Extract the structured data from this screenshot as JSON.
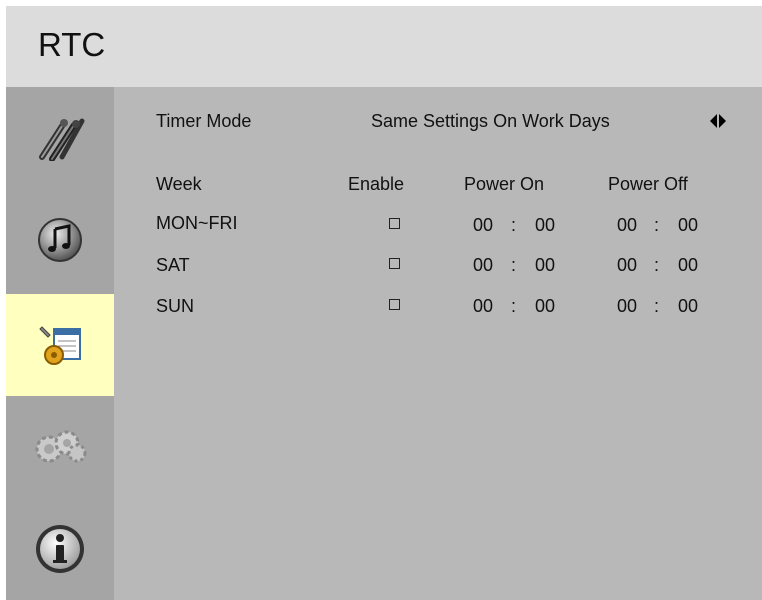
{
  "header": {
    "title": "RTC"
  },
  "sidebar": {
    "items": [
      {
        "icon": "wrench-tools-icon",
        "active": false
      },
      {
        "icon": "music-note-icon",
        "active": false
      },
      {
        "icon": "settings-calendar-icon",
        "active": true
      },
      {
        "icon": "gears-icon",
        "active": false
      },
      {
        "icon": "info-icon",
        "active": false
      }
    ]
  },
  "timer_mode": {
    "label": "Timer Mode",
    "value": "Same Settings On Work Days",
    "arrow_icon": "left-right-arrow-icon"
  },
  "table": {
    "headers": {
      "week": "Week",
      "enable": "Enable",
      "power_on": "Power On",
      "power_off": "Power Off"
    },
    "rows": [
      {
        "day": "MON~FRI",
        "enabled": false,
        "on_h": "00",
        "on_m": "00",
        "off_h": "00",
        "off_m": "00"
      },
      {
        "day": "SAT",
        "enabled": false,
        "on_h": "00",
        "on_m": "00",
        "off_h": "00",
        "off_m": "00"
      },
      {
        "day": "SUN",
        "enabled": false,
        "on_h": "00",
        "on_m": "00",
        "off_h": "00",
        "off_m": "00"
      }
    ],
    "separator": ":"
  },
  "colors": {
    "header_bg": "#dcdcdc",
    "sidebar_bg": "#a5a5a5",
    "content_bg": "#b8b8b8",
    "active_item_bg": "#ffffc0"
  }
}
